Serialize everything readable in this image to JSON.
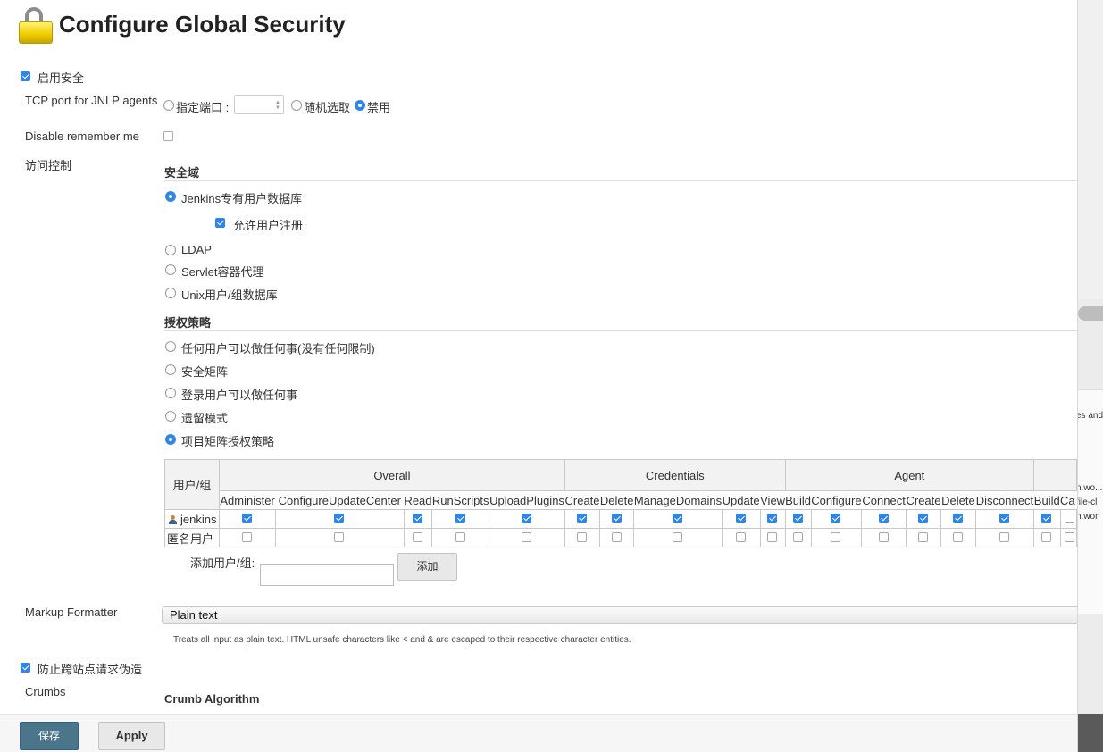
{
  "page": {
    "title": "Configure Global Security"
  },
  "enable_security": {
    "label": "启用安全",
    "checked": true
  },
  "jnlp": {
    "label": "TCP port for JNLP agents",
    "options": [
      {
        "label": "指定端口 :",
        "selected": false
      },
      {
        "label": "随机选取",
        "selected": false
      },
      {
        "label": "禁用",
        "selected": true
      }
    ],
    "port_value": ""
  },
  "remember_me": {
    "label": "Disable remember me",
    "checked": false
  },
  "access_control": {
    "label": "访问控制"
  },
  "security_realm": {
    "heading": "安全域",
    "options": [
      {
        "label": "Jenkins专有用户数据库",
        "selected": true
      },
      {
        "label": "LDAP",
        "selected": false
      },
      {
        "label": "Servlet容器代理",
        "selected": false
      },
      {
        "label": "Unix用户/组数据库",
        "selected": false
      }
    ],
    "allow_signup": {
      "label": "允许用户注册",
      "checked": true
    }
  },
  "authorization": {
    "heading": "授权策略",
    "options": [
      {
        "label": "任何用户可以做任何事(没有任何限制)",
        "selected": false
      },
      {
        "label": "安全矩阵",
        "selected": false
      },
      {
        "label": "登录用户可以做任何事",
        "selected": false
      },
      {
        "label": "遗留模式",
        "selected": false
      },
      {
        "label": "项目矩阵授权策略",
        "selected": true
      }
    ]
  },
  "matrix": {
    "user_header": "用户/组",
    "groups": [
      {
        "name": "Overall",
        "perms": [
          "Administer",
          "ConfigureUpdateCenter",
          "Read",
          "RunScripts",
          "UploadPlugins"
        ]
      },
      {
        "name": "Credentials",
        "perms": [
          "Create",
          "Delete",
          "ManageDomains",
          "Update",
          "View"
        ]
      },
      {
        "name": "Agent",
        "perms": [
          "Build",
          "Configure",
          "Connect",
          "Create",
          "Delete",
          "Disconnect"
        ]
      },
      {
        "name": "",
        "perms": [
          "Build",
          "Ca"
        ]
      }
    ],
    "rows": [
      {
        "name": "jenkins",
        "values": [
          true,
          true,
          true,
          true,
          true,
          true,
          true,
          true,
          true,
          true,
          true,
          true,
          true,
          true,
          true,
          true,
          true,
          false
        ]
      },
      {
        "name": "匿名用户",
        "values": [
          false,
          false,
          false,
          false,
          false,
          false,
          false,
          false,
          false,
          false,
          false,
          false,
          false,
          false,
          false,
          false,
          false,
          false
        ]
      }
    ],
    "add_label": "添加用户/组:",
    "add_button": "添加",
    "add_value": ""
  },
  "markup": {
    "label": "Markup Formatter",
    "selected": "Plain text",
    "help": "Treats all input as plain text. HTML unsafe characters like < and & are escaped to their respective character entities."
  },
  "csrf": {
    "label": "防止跨站点请求伪造",
    "checked": true
  },
  "crumbs": {
    "label": "Crumbs",
    "algorithm_heading": "Crumb Algorithm"
  },
  "buttons": {
    "save": "保存",
    "apply": "Apply"
  },
  "background_window": {
    "line1": "es and",
    "line2": "n.wo...",
    "line3": "file-cl",
    "line4": "n.won"
  },
  "colors": {
    "accent": "#2f86e8",
    "save_button": "#4b758b"
  }
}
